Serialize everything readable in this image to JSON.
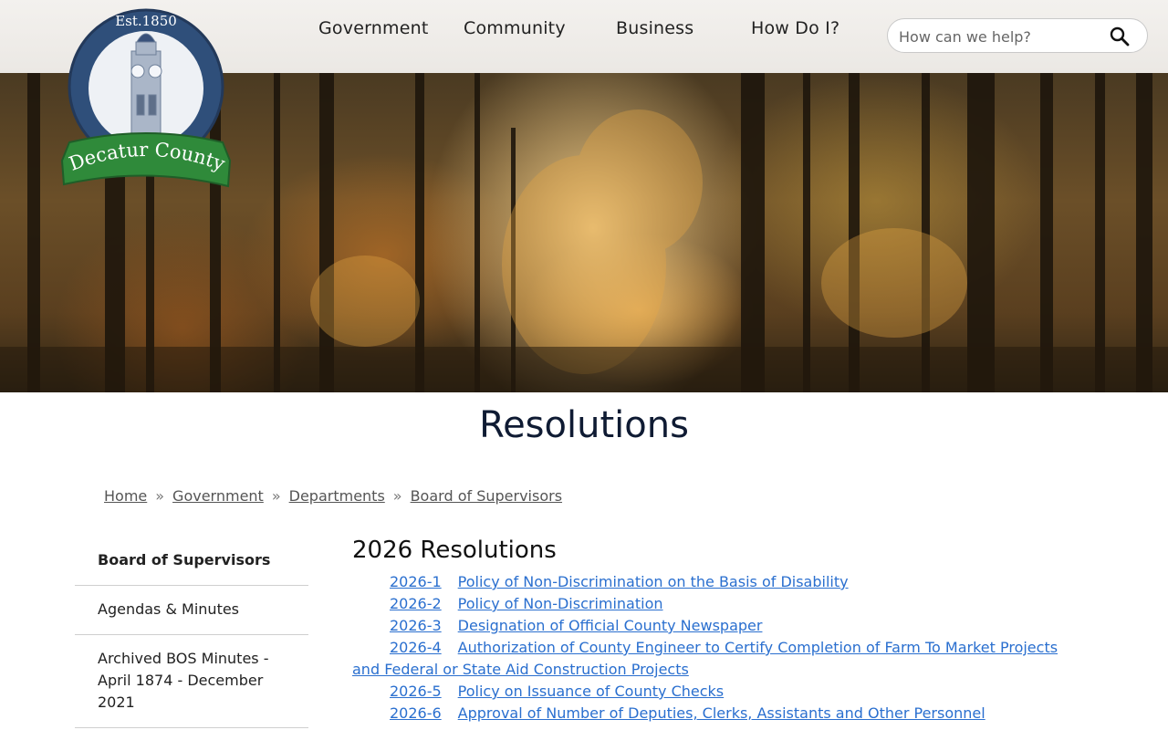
{
  "site": {
    "logo": {
      "est_text": "Est.1850",
      "name": "Decatur County",
      "colors": {
        "ring": "#2f4f7a",
        "ribbon": "#2f8a3a"
      }
    }
  },
  "nav": {
    "items": [
      {
        "label": "Government"
      },
      {
        "label": "Community"
      },
      {
        "label": "Business"
      },
      {
        "label": "How Do I?"
      }
    ]
  },
  "search": {
    "placeholder": "How can we help?",
    "icon": "search-icon"
  },
  "page": {
    "title": "Resolutions"
  },
  "breadcrumb": {
    "items": [
      {
        "label": "Home"
      },
      {
        "label": "Government"
      },
      {
        "label": "Departments"
      },
      {
        "label": "Board of Supervisors"
      }
    ],
    "separator": "»"
  },
  "sidebar": {
    "items": [
      {
        "label": "Board of Supervisors",
        "active": true
      },
      {
        "label": "Agendas & Minutes"
      },
      {
        "label": "Archived BOS Minutes - April 1874 - December 2021"
      }
    ]
  },
  "main": {
    "section_title": "2026 Resolutions",
    "resolutions": [
      {
        "number": "2026-1",
        "title": "Policy of Non-Discrimination on the Basis of Disability"
      },
      {
        "number": "2026-2",
        "title": "Policy of Non-Discrimination"
      },
      {
        "number": "2026-3",
        "title": "Designation of Official County Newspaper"
      },
      {
        "number": "2026-4",
        "title": "Authorization of County Engineer to Certify Completion of Farm To Market Projects and Federal or State Aid Construction Projects"
      },
      {
        "number": "2026-5",
        "title": "Policy on Issuance of County Checks"
      },
      {
        "number": "2026-6",
        "title": "Approval of Number of Deputies, Clerks, Assistants and Other Personnel"
      }
    ],
    "link_color": "#2a6fcf"
  }
}
